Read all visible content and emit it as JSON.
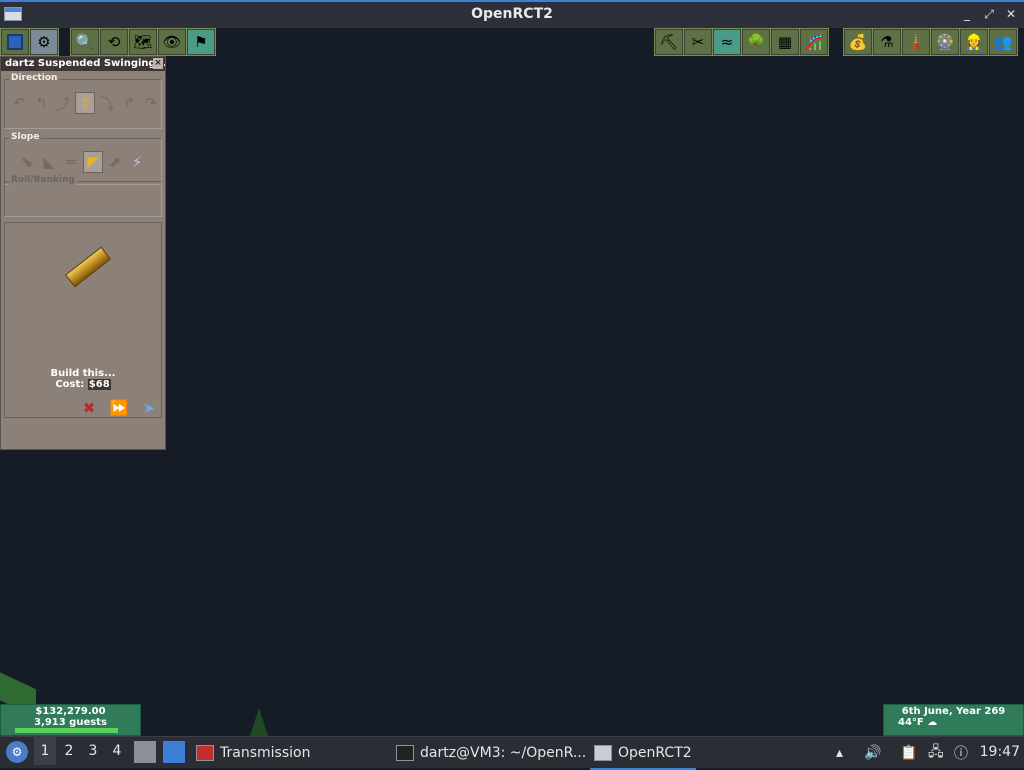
{
  "window": {
    "title": "OpenRCT2",
    "controls": [
      "_",
      "⤢",
      "✕"
    ]
  },
  "toolbar_left": [
    {
      "name": "save-button",
      "glyph": ""
    },
    {
      "name": "options-button",
      "glyph": "⚙"
    },
    {
      "name": "zoom-button",
      "glyph": "🔍"
    },
    {
      "name": "rotate-button",
      "glyph": "⟲"
    },
    {
      "name": "map-button",
      "glyph": "🗺"
    },
    {
      "name": "view-button",
      "glyph": "👁"
    },
    {
      "name": "scenery-warning-button",
      "glyph": "⚑"
    }
  ],
  "toolbar_right": [
    {
      "name": "landscape-button",
      "glyph": "⛏"
    },
    {
      "name": "clear-scenery-button",
      "glyph": "✂"
    },
    {
      "name": "water-button",
      "glyph": "≈"
    },
    {
      "name": "scenery-button",
      "glyph": "🌳"
    },
    {
      "name": "footpath-button",
      "glyph": "▦"
    },
    {
      "name": "ride-button",
      "glyph": "🎢"
    },
    {
      "name": "finances-button",
      "glyph": "💰"
    },
    {
      "name": "research-button",
      "glyph": "⚗"
    },
    {
      "name": "rides-list-button",
      "glyph": "🗼"
    },
    {
      "name": "park-button",
      "glyph": "🎡"
    },
    {
      "name": "staff-button",
      "glyph": "👷"
    },
    {
      "name": "guests-button",
      "glyph": "👥"
    }
  ],
  "construction": {
    "title": "dartz Suspended Swinging ...",
    "close": "×",
    "direction_label": "Direction",
    "direction_icons": [
      "↶",
      "↰",
      "⤴",
      "⇧",
      "⤵",
      "↱",
      "↷"
    ],
    "slope_label": "Slope",
    "slope_icons": [
      "⬊",
      "◣",
      "═",
      "◤",
      "⬈",
      "⚡"
    ],
    "roll_label": "Roll/Banking",
    "build_label": "Build this...",
    "cost_label": "Cost:",
    "cost_value": "$68",
    "actions": [
      "✖",
      "⏩",
      "➤"
    ]
  },
  "status_left": {
    "money": "$132,279.00",
    "guests": "3,913 guests",
    "rating": 0.91
  },
  "status_right": {
    "date": "6th June, Year 269",
    "weather": "44°F",
    "weather_icon": "☁"
  },
  "taskbar": {
    "desktops": [
      "1",
      "2",
      "3",
      "4"
    ],
    "apps": [
      {
        "label": "Transmission",
        "icon": "transmission-icon"
      },
      {
        "label": "dartz@VM3: ~/OpenR...",
        "icon": "terminal-icon"
      },
      {
        "label": "OpenRCT2",
        "icon": "window-icon"
      }
    ],
    "clock": "19:47"
  },
  "colors": {
    "accent": "#3d7fd6",
    "status_green": "#2f7b5a",
    "window_bg": "#8c8179",
    "viewport_bg": "#161c26"
  }
}
